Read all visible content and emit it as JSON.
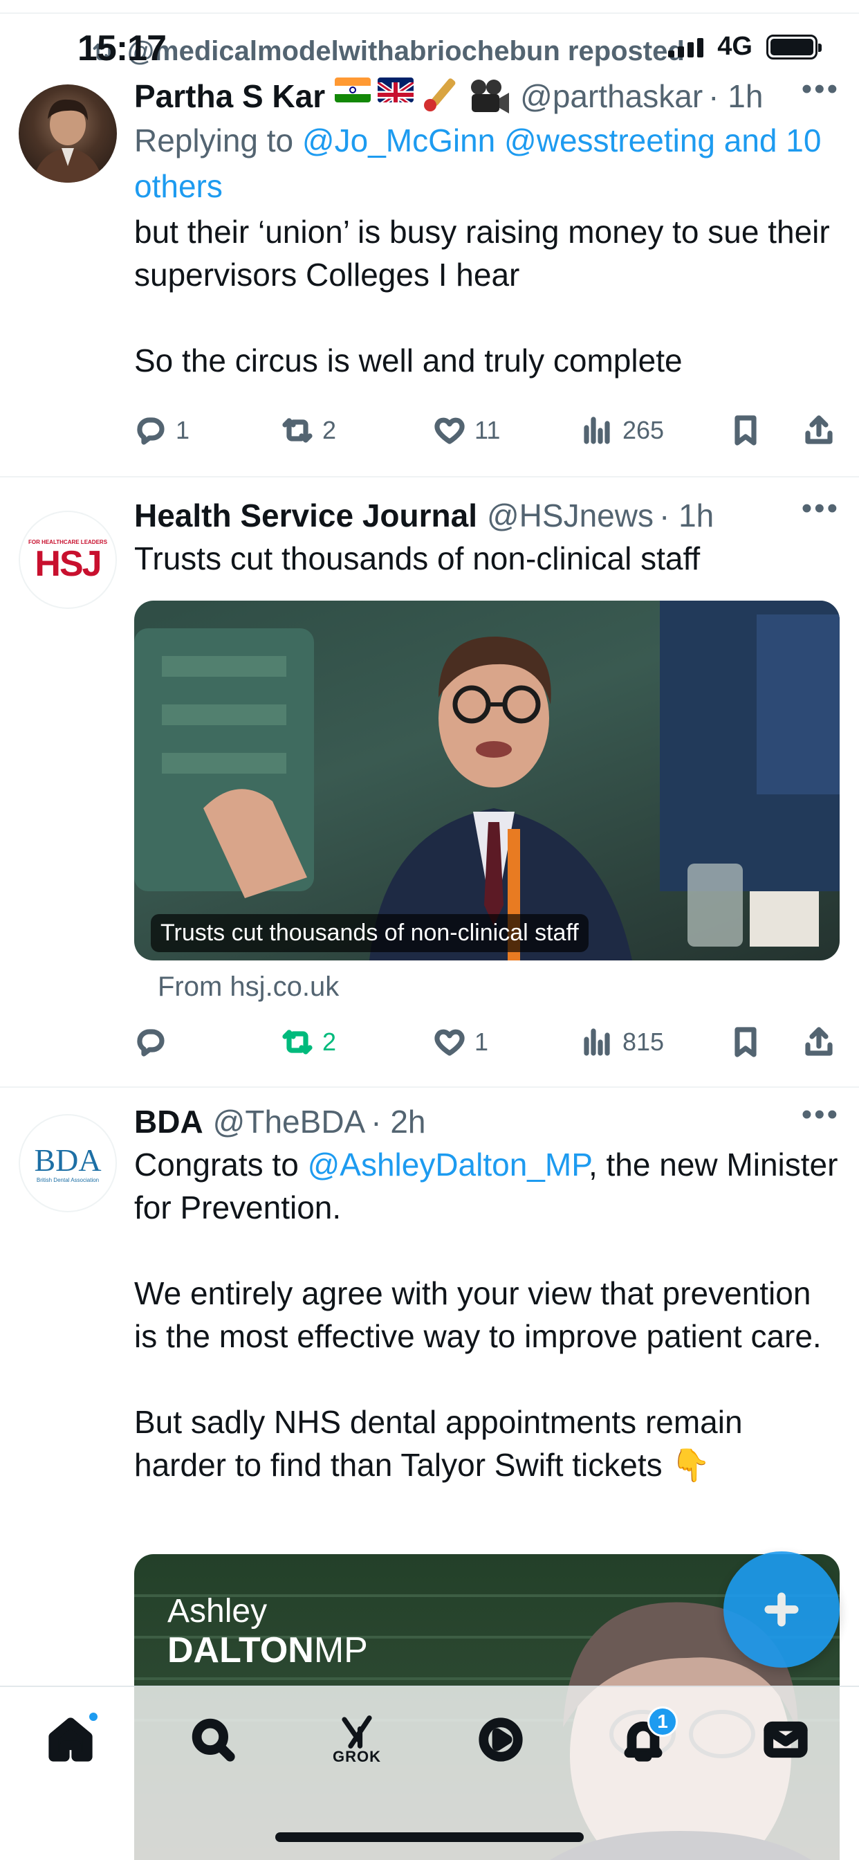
{
  "status": {
    "time": "15:17",
    "network": "4G"
  },
  "repost": {
    "text": "@medicalmodelwithabriochebun reposted"
  },
  "tweets": [
    {
      "name": "Partha S Kar",
      "handle": "@parthaskar",
      "time": "· 1h",
      "reply_prefix": "Replying to ",
      "reply_mentions": "@Jo_McGinn @wesstreeting and 10 others",
      "text": "but their ‘union’ is busy raising money to sue their supervisors Colleges I hear\n\nSo the circus is well and truly complete",
      "stats": {
        "replies": "1",
        "reposts": "2",
        "likes": "11",
        "views": "265"
      }
    },
    {
      "name": "Health Service Journal",
      "handle": "@HSJnews",
      "time": "· 1h",
      "text": "Trusts cut thousands of non-clinical staff",
      "avatar_text": "HSJ",
      "avatar_small": "FOR HEALTHCARE LEADERS",
      "media_caption": "Trusts cut thousands of non-clinical staff",
      "from": "From hsj.co.uk",
      "stats": {
        "replies": "",
        "reposts": "2",
        "likes": "1",
        "views": "815"
      }
    },
    {
      "name": "BDA",
      "handle": "@TheBDA",
      "time": "· 2h",
      "text_prefix": "Congrats to ",
      "mention": "@AshleyDalton_MP",
      "text_suffix": ", the new Minister for Prevention.\n\nWe entirely agree with your view that prevention is the most effective way to improve patient care.\n\nBut sadly NHS dental appointments remain harder to find than Talyor Swift tickets 👇",
      "avatar_text": "BDA",
      "avatar_small": "British Dental Association",
      "media_title_1": "Ashley",
      "media_title_2": "DALTON",
      "media_title_3": "MP"
    }
  ],
  "tabbar": {
    "grok_label": "GROK",
    "notifications_badge": "1"
  },
  "colors": {
    "accent": "#1d9bf0",
    "repost_green": "#00ba7c",
    "muted": "#536471"
  }
}
